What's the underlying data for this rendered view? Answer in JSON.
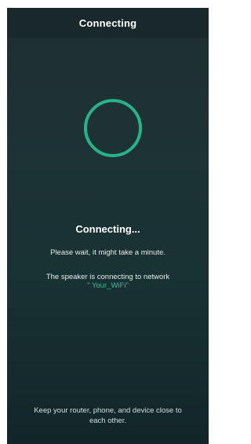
{
  "header": {
    "title": "Connecting"
  },
  "spinner": {
    "icon": "loading-ring",
    "color": "#27b38a"
  },
  "status": {
    "title": "Connecting...",
    "wait_message": "Please wait, it might take a minute.",
    "network_message": "The speaker is connecting to network",
    "network_name": "\" Your_WiFi\""
  },
  "footer": {
    "tip": "Keep your router, phone, and device close to each other."
  },
  "colors": {
    "accent": "#27b38a",
    "background": "#1d3336",
    "header_bg": "#19292b"
  }
}
